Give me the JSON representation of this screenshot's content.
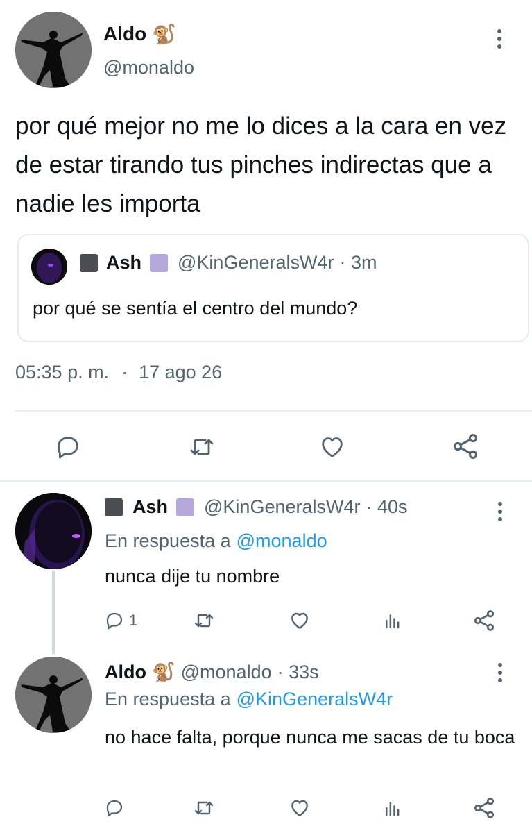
{
  "main_tweet": {
    "author_name": "Aldo",
    "author_emoji": "🐒",
    "author_handle": "@monaldo",
    "text": "por qué mejor no me lo dices a la cara en vez de estar tirando tus pinches indirectas que a nadie les importa",
    "quoted": {
      "author_name": "Ash",
      "author_handle": "@KinGeneralsW4r",
      "time": "· 3m",
      "text": "por qué se sentía el centro del mundo?"
    },
    "timestamp": "05:35 p. m.",
    "separator": "·",
    "date": "17 ago 26"
  },
  "replies": [
    {
      "author_name": "Ash",
      "author_handle": "@KinGeneralsW4r",
      "time": "· 40s",
      "reply_prefix": "En respuesta a",
      "reply_to": "@monaldo",
      "text": "nunca dije tu nombre",
      "reply_count": "1"
    },
    {
      "author_name": "Aldo",
      "author_emoji": "🐒",
      "author_handle": "@monaldo",
      "time": "· 33s",
      "reply_prefix": "En respuesta a",
      "reply_to": "@KinGeneralsW4r",
      "text": "no hace falta, porque nunca me sacas de tu boca",
      "reply_count": ""
    }
  ],
  "colors": {
    "link_blue": "#1d9bf0",
    "secondary_gray": "#536471",
    "badge_dark": "#4a4d52",
    "badge_purple": "#b8a7dc",
    "avatar_purple": "#7b2bd9"
  }
}
